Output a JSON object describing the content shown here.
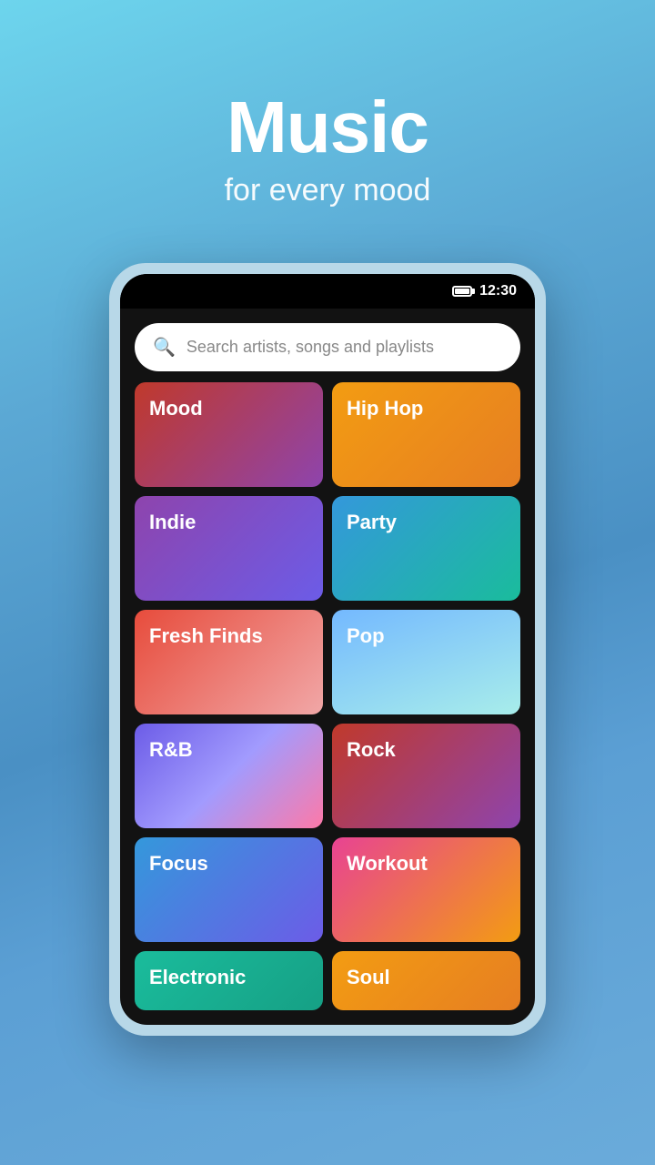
{
  "header": {
    "title": "Music",
    "subtitle": "for every mood"
  },
  "statusBar": {
    "time": "12:30"
  },
  "search": {
    "placeholder": "Search artists, songs and playlists"
  },
  "genres": [
    {
      "id": "mood",
      "label": "Mood",
      "cardClass": "card-mood"
    },
    {
      "id": "hiphop",
      "label": "Hip Hop",
      "cardClass": "card-hiphop"
    },
    {
      "id": "indie",
      "label": "Indie",
      "cardClass": "card-indie"
    },
    {
      "id": "party",
      "label": "Party",
      "cardClass": "card-party"
    },
    {
      "id": "freshfinds",
      "label": "Fresh Finds",
      "cardClass": "card-freshfinds"
    },
    {
      "id": "pop",
      "label": "Pop",
      "cardClass": "card-pop"
    },
    {
      "id": "rb",
      "label": "R&B",
      "cardClass": "card-rb"
    },
    {
      "id": "rock",
      "label": "Rock",
      "cardClass": "card-rock"
    },
    {
      "id": "focus",
      "label": "Focus",
      "cardClass": "card-focus"
    },
    {
      "id": "workout",
      "label": "Workout",
      "cardClass": "card-workout"
    },
    {
      "id": "electronic",
      "label": "Electronic",
      "cardClass": "card-electronic"
    },
    {
      "id": "soul",
      "label": "Soul",
      "cardClass": "card-hiphop"
    }
  ]
}
